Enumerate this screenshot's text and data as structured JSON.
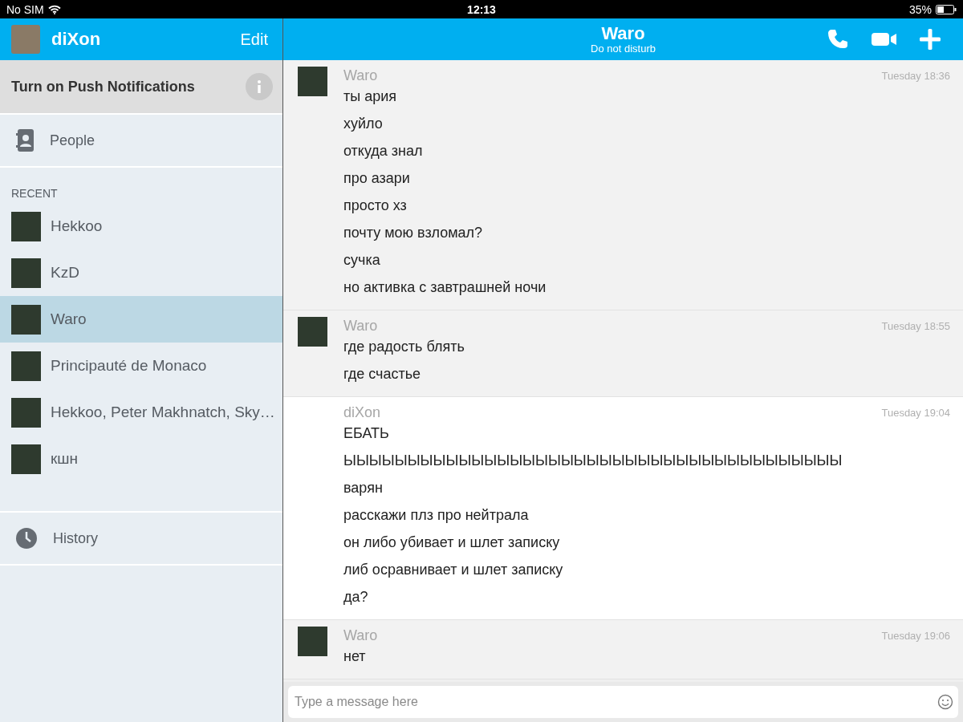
{
  "status_bar": {
    "carrier": "No SIM",
    "time": "12:13",
    "battery": "35%"
  },
  "sidebar": {
    "profile_name": "diXon",
    "edit": "Edit",
    "push_notice": "Turn on Push Notifications",
    "people": "People",
    "recent_label": "RECENT",
    "recent": [
      {
        "name": "Hekkoo",
        "selected": false
      },
      {
        "name": "KzD",
        "selected": false
      },
      {
        "name": "Waro",
        "selected": true
      },
      {
        "name": "Principauté de Monaco",
        "selected": false
      },
      {
        "name": "Hekkoo, Peter Makhnatch, Sky…",
        "selected": false
      },
      {
        "name": "кшн",
        "selected": false
      }
    ],
    "history": "History"
  },
  "chat": {
    "title": "Waro",
    "status": "Do not disturb",
    "messages": [
      {
        "kind": "incoming",
        "sender": "Waro",
        "time": "Tuesday 18:36",
        "lines": [
          "ты ария",
          "хуйло",
          "откуда знал",
          "про азари",
          "просто хз",
          "почту мою взломал?",
          "сучка",
          "но активка с завтрашней ночи"
        ]
      },
      {
        "kind": "incoming",
        "sender": "Waro",
        "time": "Tuesday 18:55",
        "lines": [
          "где радость блять",
          "где счастье"
        ]
      },
      {
        "kind": "outgoing",
        "sender": "diXon",
        "time": "Tuesday 19:04",
        "lines": [
          "ЕБАТЬ",
          "ЫЫЫЫЫЫЫЫЫЫЫЫЫЫЫЫЫЫЫЫЫЫЫЫЫЫЫЫЫЫЫЫЫЫЫЫЫЫЫ",
          "варян",
          "расскажи плз про нейтрала",
          "он либо убивает и шлет записку",
          "либ осравнивает и шлет записку",
          "да?"
        ]
      },
      {
        "kind": "incoming",
        "sender": "Waro",
        "time": "Tuesday 19:06",
        "lines": [
          "нет"
        ]
      }
    ],
    "input": {
      "placeholder": "Type a message here"
    }
  }
}
